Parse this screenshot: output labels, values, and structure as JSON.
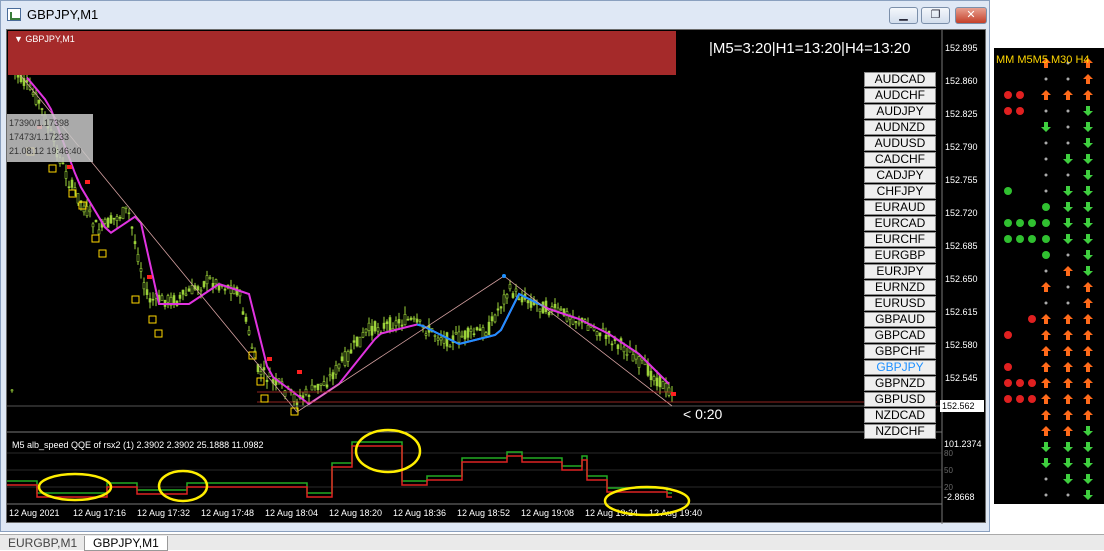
{
  "window": {
    "title": "GBPJPY,M1",
    "minimize": "▁",
    "restore": "❐",
    "close": "✕"
  },
  "chart": {
    "symbol_label": "GBPJPY,M1",
    "timer_text": "|M5=3:20|H1=13:20|H4=13:20",
    "countdown": "< 0:20",
    "current_price": "152.562",
    "tooltip_lines": [
      "17390/1.17398",
      "17473/1.17233",
      "21.08.12 19:46:40"
    ],
    "price_axis": [
      "152.895",
      "152.860",
      "152.825",
      "152.790",
      "152.755",
      "152.720",
      "152.685",
      "152.650",
      "152.615",
      "152.580",
      "152.545"
    ],
    "time_axis": [
      "12 Aug 2021",
      "12 Aug 17:16",
      "12 Aug 17:32",
      "12 Aug 17:48",
      "12 Aug 18:04",
      "12 Aug 18:20",
      "12 Aug 18:36",
      "12 Aug 18:52",
      "12 Aug 19:08",
      "12 Aug 19:24",
      "12 Aug 19:40"
    ],
    "indicator_label": "M5 alb_speed QQE of rsx2 (1) 2.3902 2.3902 25.1888 11.0982",
    "indicator_top": "101.2374",
    "indicator_bottom": "-2.8668",
    "indicator_levels": [
      "80",
      "50",
      "20"
    ]
  },
  "symbols": [
    "AUDCAD",
    "AUDCHF",
    "AUDJPY",
    "AUDNZD",
    "AUDUSD",
    "CADCHF",
    "CADJPY",
    "CHFJPY",
    "EURAUD",
    "EURCAD",
    "EURCHF",
    "EURGBP",
    "EURJPY",
    "EURNZD",
    "EURUSD",
    "GBPAUD",
    "GBPCAD",
    "GBPCHF",
    "GBPJPY",
    "GBPNZD",
    "GBPUSD",
    "NZDCAD",
    "NZDCHF"
  ],
  "active_symbol": "GBPJPY",
  "right_panel": {
    "headers": [
      "M",
      "M",
      "M",
      "M",
      "M",
      "30",
      "H4"
    ],
    "header_text": "MM M5M5 M30 H4"
  },
  "tabs": [
    {
      "label": "EURGBP,M1"
    },
    {
      "label": "GBPJPY,M1"
    }
  ]
}
